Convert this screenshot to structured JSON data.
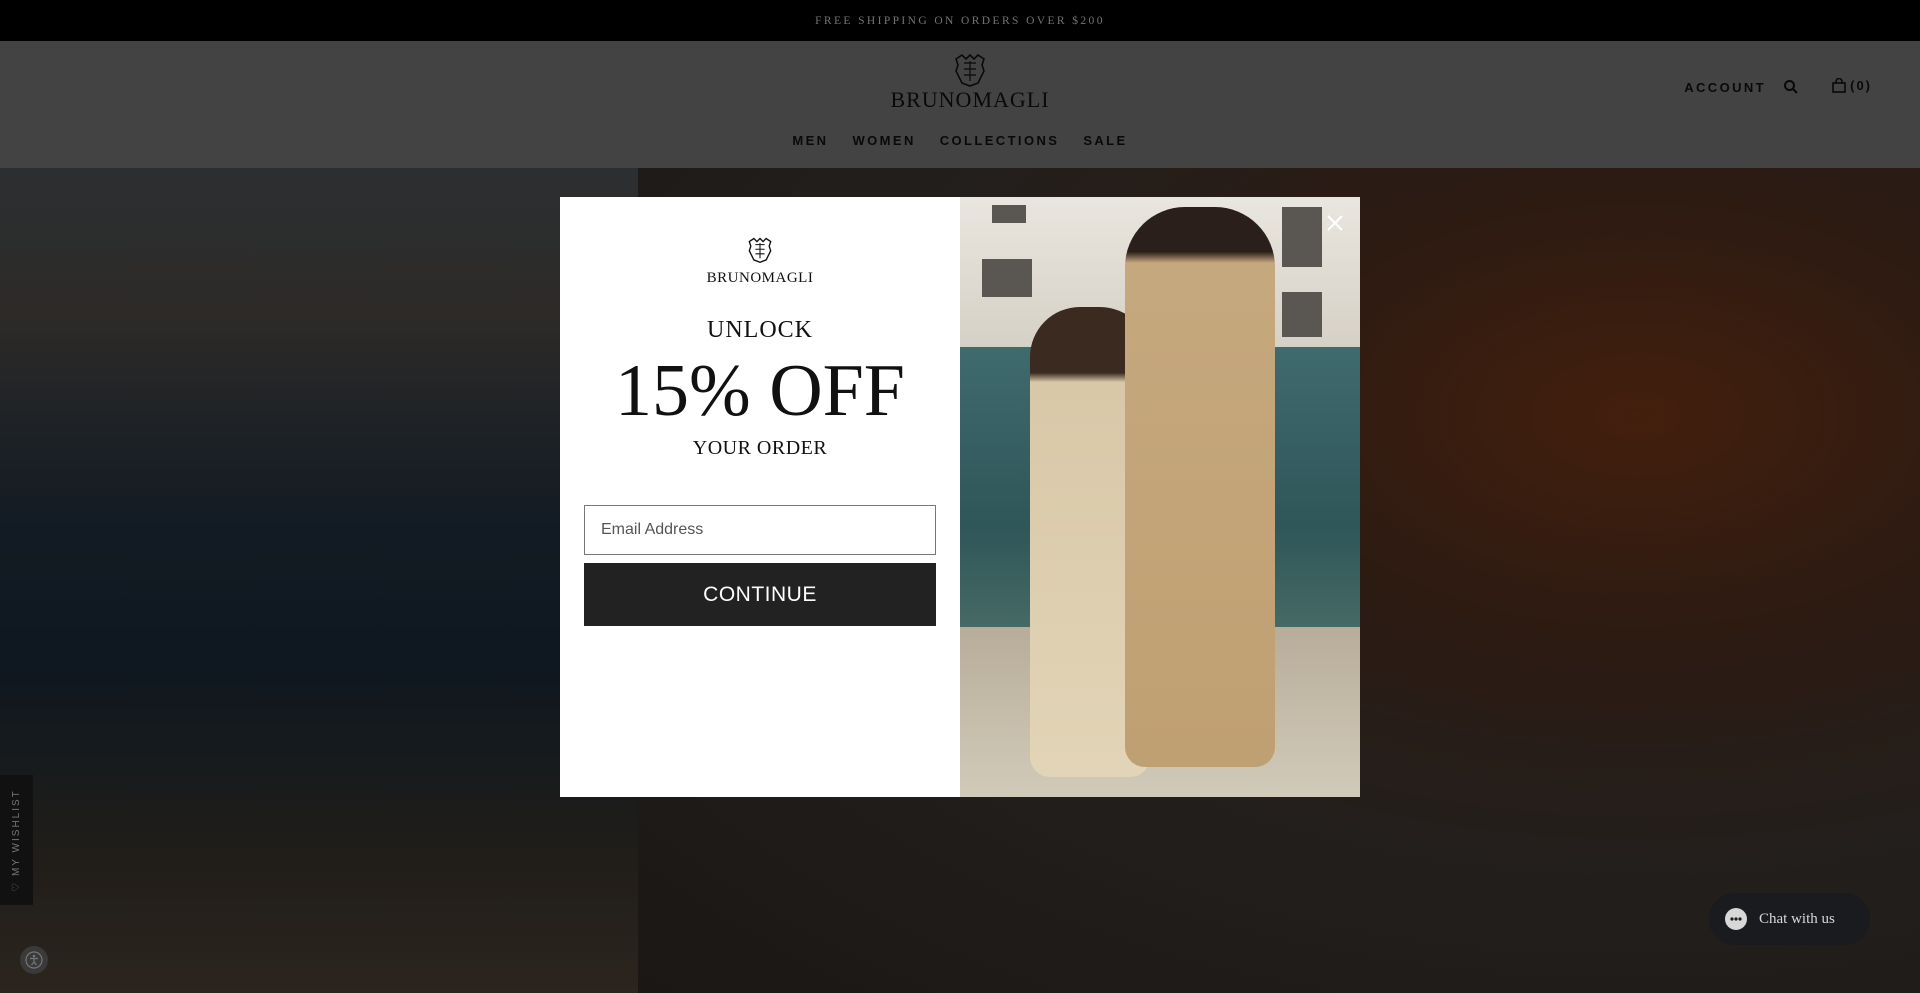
{
  "announcement": {
    "text": "FREE SHIPPING ON ORDERS OVER $200"
  },
  "header": {
    "brand": "BRUNOMAGLI",
    "account_label": "ACCOUNT",
    "cart_label": "(0)",
    "nav": [
      {
        "label": "MEN"
      },
      {
        "label": "WOMEN"
      },
      {
        "label": "COLLECTIONS"
      },
      {
        "label": "SALE"
      }
    ]
  },
  "sidebar": {
    "wishlist_label": "MY WISHLIST"
  },
  "chat": {
    "label": "Chat with us"
  },
  "modal": {
    "brand": "BRUNOMAGLI",
    "headline_top": "UNLOCK",
    "headline_main": "15% OFF",
    "headline_bottom": "YOUR ORDER",
    "email_placeholder": "Email Address",
    "continue_label": "CONTINUE"
  },
  "icons": {
    "search": "search-icon",
    "cart": "shopping-bag-icon",
    "close": "close-icon",
    "accessibility": "accessibility-icon",
    "heart": "heart-icon",
    "chat": "chat-bubble-icon",
    "crest": "brand-crest-icon"
  },
  "colors": {
    "button": "#222222",
    "chat_bg": "#1a1b1e",
    "announce_bg": "#000000"
  }
}
